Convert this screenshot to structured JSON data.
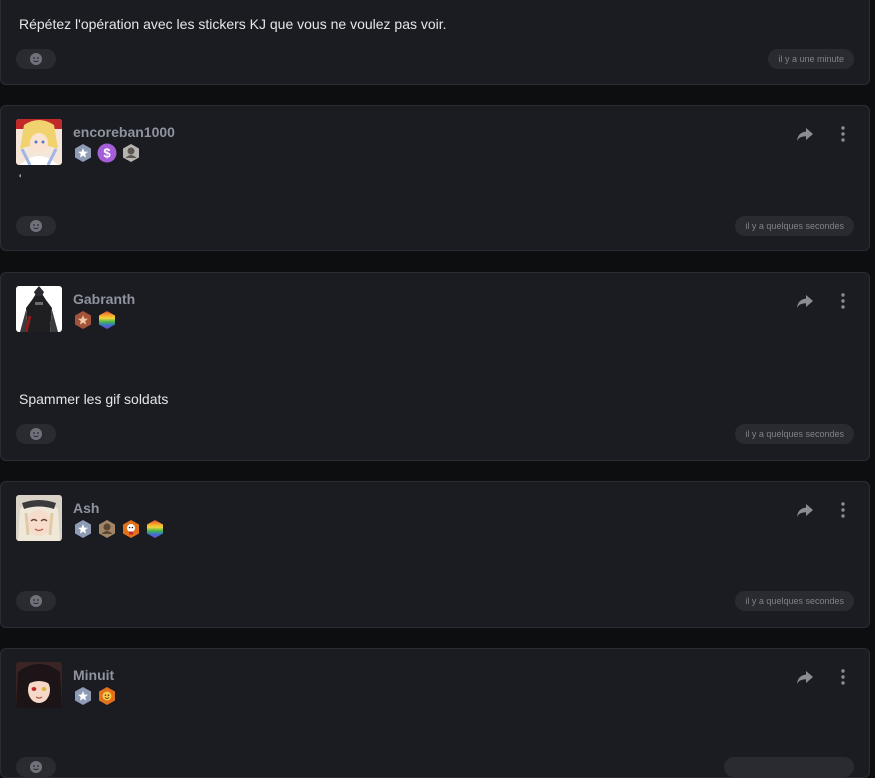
{
  "posts": [
    {
      "text": "Répétez l'opération avec les stickers KJ que vous ne voulez pas voir.",
      "timestamp": "il y a une minute"
    },
    {
      "username": "encoreban1000",
      "badges": [
        "star-badge",
        "dollar-badge",
        "portrait-badge"
      ],
      "text": "'",
      "timestamp": "il y a quelques secondes"
    },
    {
      "username": "Gabranth",
      "badges": [
        "bronze-star-badge",
        "rainbow-badge"
      ],
      "text": "Spammer les gif soldats",
      "timestamp": "il y a quelques secondes"
    },
    {
      "username": "Ash",
      "badges": [
        "star-badge",
        "portrait-badge",
        "mascot-badge",
        "rainbow-badge"
      ],
      "text": "",
      "timestamp": "il y a quelques secondes"
    },
    {
      "username": "Minuit",
      "badges": [
        "star-badge",
        "smiley-badge"
      ],
      "text": "",
      "timestamp": ""
    }
  ],
  "colors": {
    "background": "#0d0e10",
    "card": "#1b1c21",
    "border": "#2c2d33",
    "username": "#8f939d",
    "pill": "#2a2b31"
  }
}
